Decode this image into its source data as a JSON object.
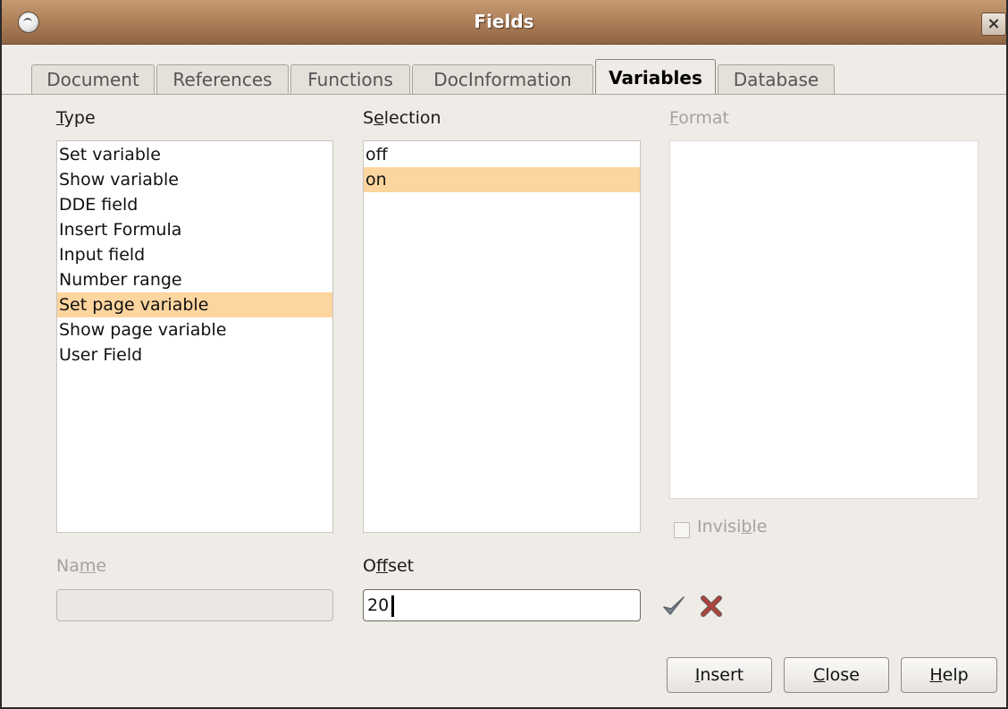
{
  "window": {
    "title": "Fields",
    "close_glyph": "×"
  },
  "tabs": [
    {
      "label": "Document",
      "active": false
    },
    {
      "label": "References",
      "active": false
    },
    {
      "label": "Functions",
      "active": false
    },
    {
      "label": "DocInformation",
      "active": false
    },
    {
      "label": "Variables",
      "active": true
    },
    {
      "label": "Database",
      "active": false
    }
  ],
  "type": {
    "label_mnemonic": "T",
    "label_rest": "ype",
    "items": [
      "Set variable",
      "Show variable",
      "DDE field",
      "Insert Formula",
      "Input field",
      "Number range",
      "Set page variable",
      "Show page variable",
      "User Field"
    ],
    "selected_index": 6
  },
  "selection": {
    "label_pre": "S",
    "label_mnemonic": "e",
    "label_rest": "lection",
    "items": [
      "off",
      "on"
    ],
    "selected_index": 1
  },
  "format": {
    "label_mnemonic": "F",
    "label_rest": "ormat",
    "enabled": false
  },
  "invisible": {
    "label_pre": "Invisi",
    "label_mnemonic": "b",
    "label_rest": "le",
    "checked": false,
    "enabled": false
  },
  "name": {
    "label_pre": "Na",
    "label_mnemonic": "m",
    "label_rest": "e",
    "value": "",
    "enabled": false
  },
  "offset": {
    "label_pre": "O",
    "label_mnemonic": "f",
    "label_rest": "fset",
    "value": "20"
  },
  "icons": {
    "apply": "checkmark-icon",
    "discard": "red-x-icon"
  },
  "buttons": {
    "insert": {
      "mnemonic": "I",
      "rest": "nsert"
    },
    "close": {
      "mnemonic": "C",
      "rest": "lose"
    },
    "help": {
      "mnemonic": "H",
      "rest": "elp"
    }
  },
  "colors": {
    "titlebar": "#b0825b",
    "selection_highlight": "#fdd59f",
    "dialog_bg": "#efebe7"
  }
}
